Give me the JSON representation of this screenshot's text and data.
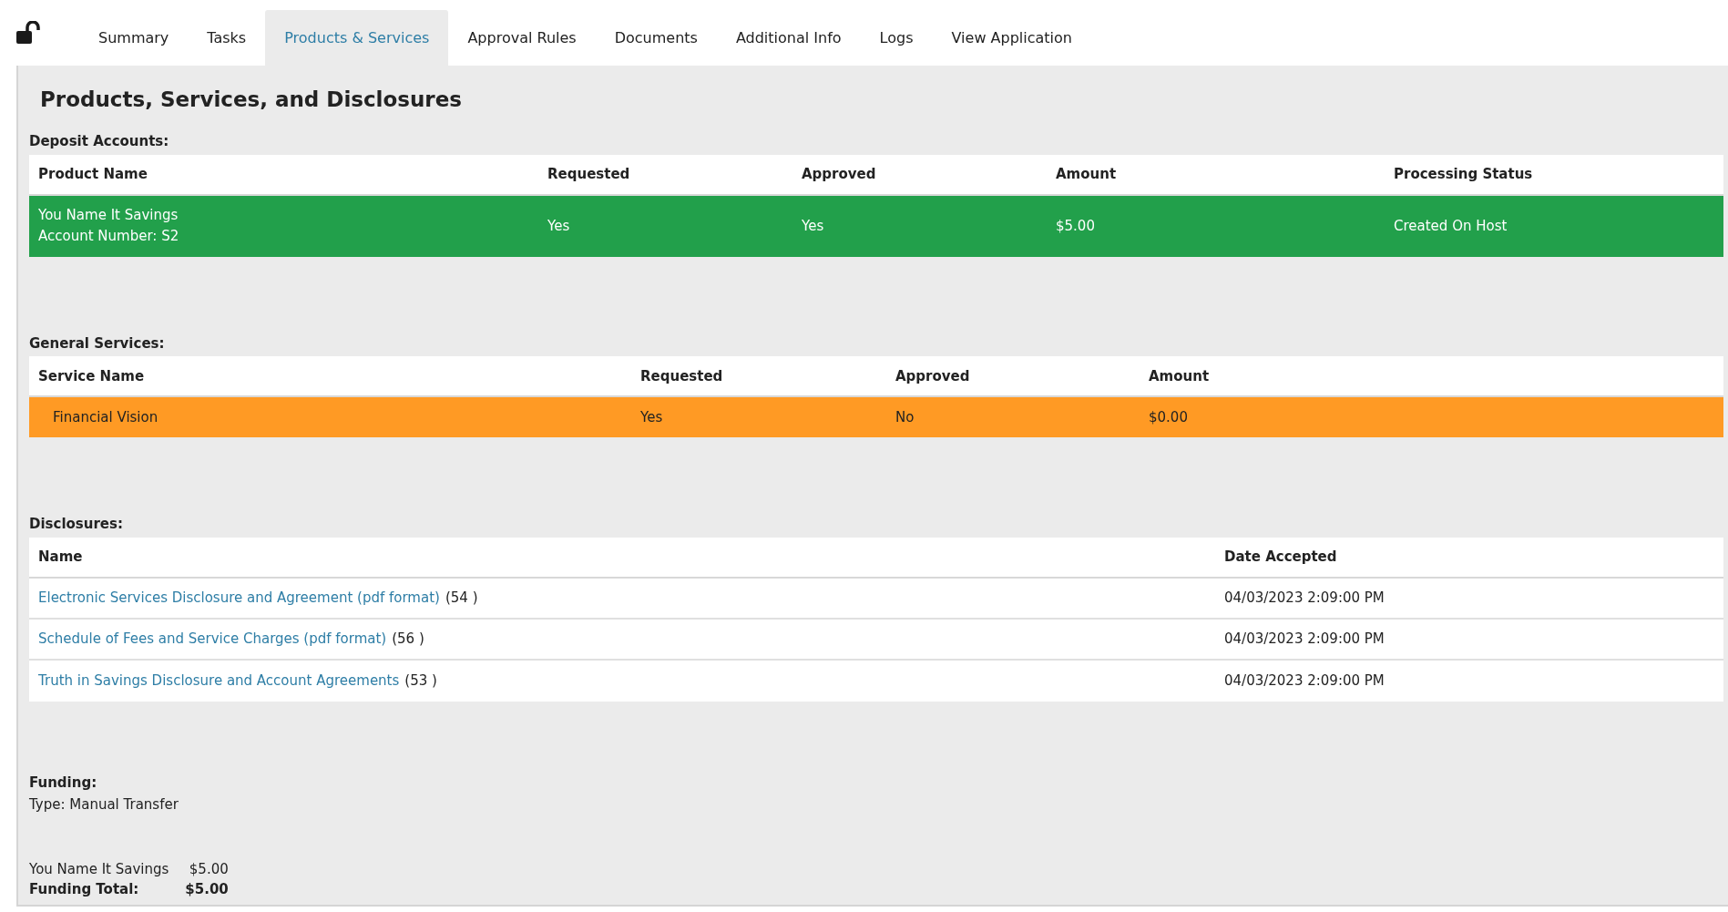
{
  "tabs": [
    {
      "label": "Summary",
      "selected": false
    },
    {
      "label": "Tasks",
      "selected": false
    },
    {
      "label": "Products & Services",
      "selected": true
    },
    {
      "label": "Approval Rules",
      "selected": false
    },
    {
      "label": "Documents",
      "selected": false
    },
    {
      "label": "Additional Info",
      "selected": false
    },
    {
      "label": "Logs",
      "selected": false
    },
    {
      "label": "View Application",
      "selected": false
    }
  ],
  "title": "Products, Services, and Disclosures",
  "deposit_accounts": {
    "label": "Deposit Accounts:",
    "columns": [
      "Product Name",
      "Requested",
      "Approved",
      "Amount",
      "Processing Status"
    ],
    "rows": [
      {
        "product_name": "You Name It Savings",
        "account_number": "Account Number: S2",
        "requested": "Yes",
        "approved": "Yes",
        "amount": "$5.00",
        "processing_status": "Created On Host",
        "color": "#22a04b"
      }
    ]
  },
  "general_services": {
    "label": "General Services:",
    "columns": [
      "Service Name",
      "Requested",
      "Approved",
      "Amount"
    ],
    "rows": [
      {
        "service_name": "Financial Vision",
        "requested": "Yes",
        "approved": "No",
        "amount": "$0.00",
        "color": "#ff9a24"
      }
    ]
  },
  "disclosures": {
    "label": "Disclosures:",
    "columns": [
      "Name",
      "Date Accepted"
    ],
    "rows": [
      {
        "name": "Electronic Services Disclosure and Agreement (pdf format)",
        "count": "(54 )",
        "date_accepted": "04/03/2023 2:09:00 PM"
      },
      {
        "name": "Schedule of Fees and Service Charges (pdf format)",
        "count": "(56 )",
        "date_accepted": "04/03/2023 2:09:00 PM"
      },
      {
        "name": "Truth in Savings Disclosure and Account Agreements",
        "count": "(53 )",
        "date_accepted": "04/03/2023 2:09:00 PM"
      }
    ]
  },
  "funding": {
    "label": "Funding:",
    "type": "Type: Manual Transfer",
    "items": [
      {
        "name": "You Name It Savings",
        "amount": "$5.00"
      }
    ],
    "total": {
      "label": "Funding Total:",
      "amount": "$5.00"
    }
  }
}
